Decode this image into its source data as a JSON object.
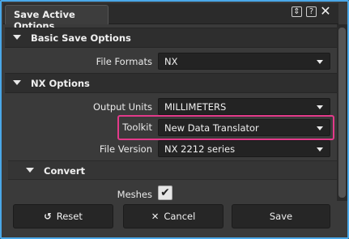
{
  "window": {
    "title": "Save Active Options",
    "pin_glyph": "⇕",
    "help_glyph": "?",
    "close_glyph": "✕"
  },
  "sections": {
    "basic": {
      "label": "Basic Save Options"
    },
    "nx": {
      "label": "NX Options"
    },
    "convert": {
      "label": "Convert"
    }
  },
  "fields": {
    "file_formats": {
      "label": "File Formats",
      "value": "NX"
    },
    "output_units": {
      "label": "Output Units",
      "value": "MILLIMETERS"
    },
    "toolkit": {
      "label": "Toolkit",
      "value": "New Data Translator"
    },
    "file_version": {
      "label": "File Version",
      "value": "NX 2212 series"
    },
    "meshes": {
      "label": "Meshes",
      "checked": true,
      "check_glyph": "✔"
    }
  },
  "buttons": {
    "reset": {
      "label": "Reset",
      "icon": "↺"
    },
    "cancel": {
      "label": "Cancel",
      "icon": "✕"
    },
    "save": {
      "label": "Save"
    }
  },
  "colors": {
    "accent_border": "#4aa8e8",
    "highlight": "#e33a8a"
  }
}
